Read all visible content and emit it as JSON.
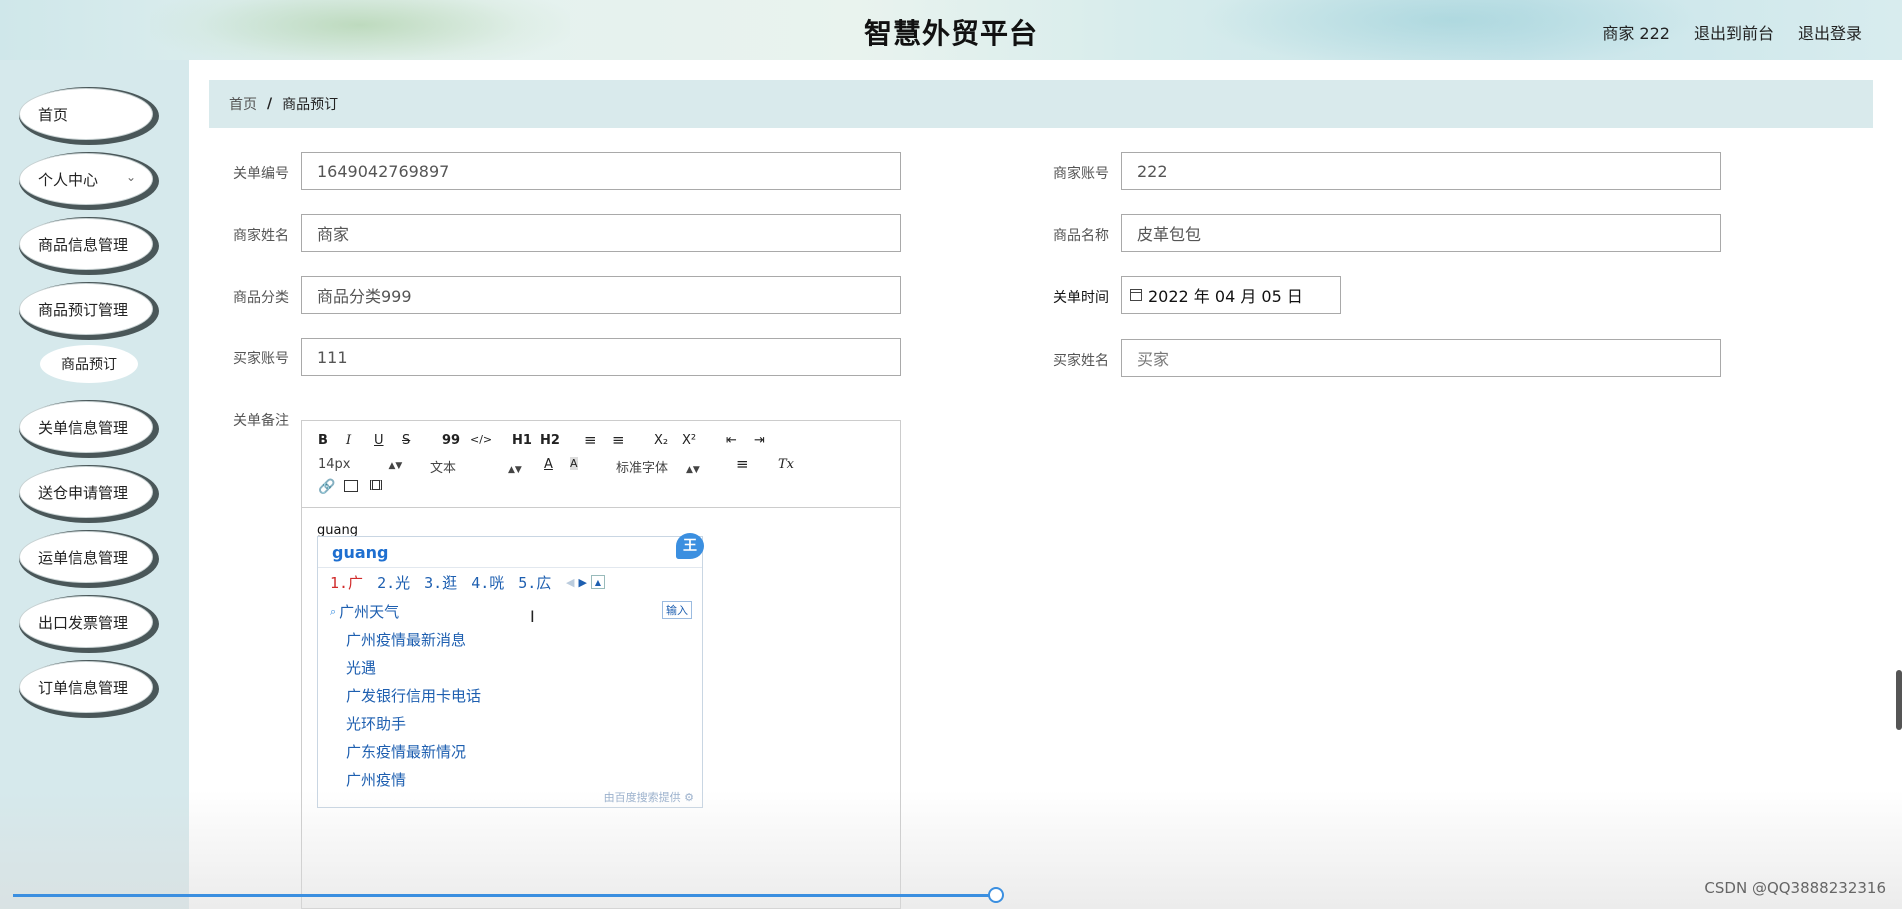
{
  "header": {
    "title": "智慧外贸平台",
    "user_label": "商家 222",
    "back_label": "退出到前台",
    "logout_label": "退出登录"
  },
  "sidebar": {
    "items": [
      {
        "label": "首页"
      },
      {
        "label": "个人中心"
      },
      {
        "label": "商品信息管理"
      },
      {
        "label": "商品预订管理"
      },
      {
        "label": "关单信息管理"
      },
      {
        "label": "送仓申请管理"
      },
      {
        "label": "运单信息管理"
      },
      {
        "label": "出口发票管理"
      },
      {
        "label": "订单信息管理"
      }
    ],
    "sub_item": "商品预订",
    "expand_icon": "chevron-down-icon"
  },
  "breadcrumb": {
    "home": "首页",
    "separator": "/",
    "current": "商品预订"
  },
  "form": {
    "order_no": {
      "label": "关单编号",
      "value": "1649042769897"
    },
    "merchant_account": {
      "label": "商家账号",
      "value": "222"
    },
    "merchant_name": {
      "label": "商家姓名",
      "value": "商家"
    },
    "product_name": {
      "label": "商品名称",
      "value": "皮革包包"
    },
    "category": {
      "label": "商品分类",
      "value": "商品分类999"
    },
    "order_time": {
      "label": "关单时间",
      "value": "2022 年 04 月 05 日"
    },
    "buyer_account": {
      "label": "买家账号",
      "value": "111"
    },
    "buyer_name": {
      "label": "买家姓名",
      "placeholder": "买家"
    },
    "remark": {
      "label": "关单备注"
    }
  },
  "editor": {
    "toolbar": {
      "bold": "B",
      "italic": "I",
      "underline": "U",
      "strike": "S",
      "quote": "99",
      "code": "</>",
      "h1": "H1",
      "h2": "H2",
      "ordered": "≡",
      "bullet": "≡",
      "sub": "X₂",
      "sup": "X²",
      "outdent": "⇤",
      "indent": "⇥",
      "size": "14px",
      "type": "文本",
      "font": "标准字体",
      "color": "A",
      "bg": "A",
      "align": "≡",
      "clean": "Tx"
    },
    "content": "guang"
  },
  "ime": {
    "input": "guang",
    "logo": "王",
    "candidates": [
      "1.广",
      "2.光",
      "3.逛",
      "4.咣",
      "5.広"
    ],
    "search_top": "广州天气",
    "enter_label": "输入",
    "suggestions": [
      "广州疫情最新消息",
      "光遇",
      "广发银行信用卡电话",
      "光环助手",
      "广东疫情最新情况",
      "广州疫情"
    ],
    "footer": "由百度搜索提供"
  },
  "watermark": "CSDN @QQ3888232316",
  "video": {
    "progress_fraction": 0.52
  }
}
